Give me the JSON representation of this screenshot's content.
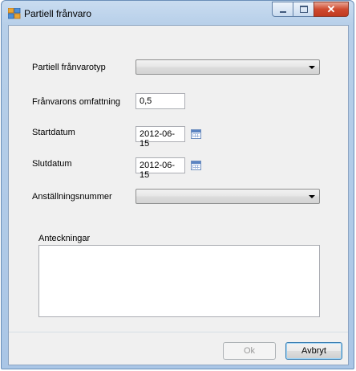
{
  "window": {
    "title": "Partiell frånvaro"
  },
  "form": {
    "absence_type": {
      "label": "Partiell frånvarotyp",
      "value": ""
    },
    "extent": {
      "label": "Frånvarons omfattning",
      "value": "0,5"
    },
    "start_date": {
      "label": "Startdatum",
      "value": "2012-06-15"
    },
    "end_date": {
      "label": "Slutdatum",
      "value": "2012-06-15"
    },
    "employee_number": {
      "label": "Anställningsnummer",
      "value": ""
    },
    "notes": {
      "label": "Anteckningar",
      "value": ""
    }
  },
  "buttons": {
    "ok_label": "Ok",
    "cancel_label": "Avbryt"
  },
  "colors": {
    "titlebar": "#b7cfe9",
    "client_background": "#f0f0f0",
    "close_button": "#cf4a2f"
  }
}
